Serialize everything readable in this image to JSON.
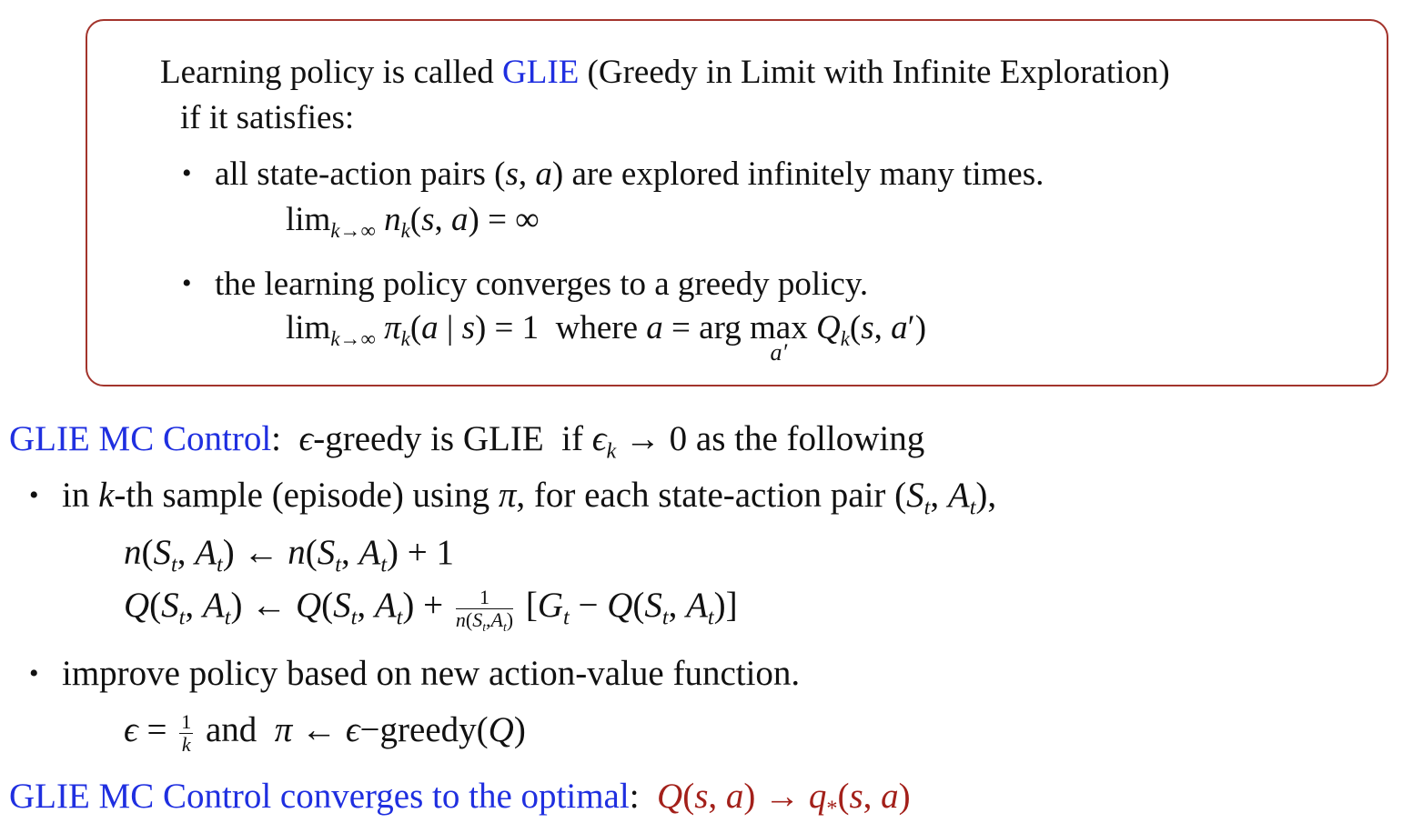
{
  "definition": {
    "intro_before": "Learning policy is called ",
    "glie": "GLIE",
    "intro_after": " (Greedy in Limit with Infinite Exploration)",
    "intro_line2": "if it satisfies:",
    "bullet1": "all state-action pairs (s, a) are explored infinitely many times.",
    "formula1": "lim_{k→∞} n_k(s, a) = ∞",
    "bullet2": "the learning policy converges to a greedy policy.",
    "formula2": "lim_{k→∞} π_k(a | s) = 1  where a = arg max_{a′} Q_k(s, a′)"
  },
  "mc_control": {
    "heading": "GLIE MC Control",
    "heading_suffix": ": ϵ-greedy is GLIE if ϵ_k → 0 as the following",
    "bullet1": "in k-th sample (episode) using π, for each state-action pair (S_t, A_t),",
    "update1": "n(S_t, A_t) ← n(S_t, A_t) + 1",
    "update2": "Q(S_t, A_t) ← Q(S_t, A_t) + 1/n(S_t,A_t) [G_t − Q(S_t, A_t)]",
    "bullet2": "improve policy based on new action-value function.",
    "policy_update": "ϵ = 1/k  and  π ← ϵ−greedy(Q)"
  },
  "conclusion": {
    "text": "GLIE MC Control converges to the optimal",
    "colon": ":",
    "formula": "Q(s, a) → q_*(s, a)"
  },
  "colors": {
    "accent_blue": "#1f2fe0",
    "accent_red": "#a3201a",
    "box_border": "#a3342c"
  }
}
